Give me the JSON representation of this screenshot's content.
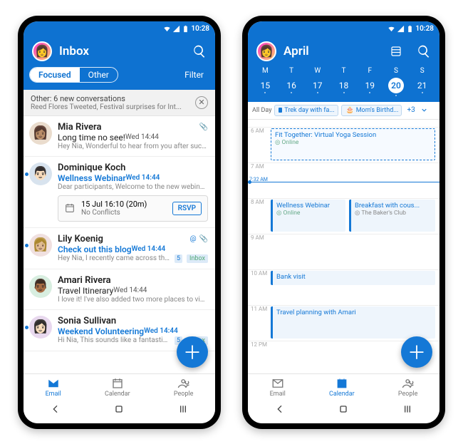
{
  "status": {
    "time": "10:28"
  },
  "inbox": {
    "title": "Inbox",
    "tabs": {
      "focused": "Focused",
      "other": "Other",
      "filter": "Filter"
    },
    "other_banner": {
      "title": "Other: 6 new conversations",
      "sub": "Reed Flores Tweeted, Festival surprises for Int..."
    },
    "meeting": {
      "time": "15 Jul 16:10 (20m)",
      "conflicts": "No Conflicts",
      "rsvp": "RSVP"
    },
    "messages": [
      {
        "sender": "Mia Rivera",
        "subject": "Long time no see!",
        "preview": "Hey Nia, Wonderful to hear from you after such...",
        "when": "Wed 14:44",
        "accent": false,
        "attach": true,
        "at": false,
        "unread": false,
        "count": null,
        "folder": null
      },
      {
        "sender": "Dominique Koch",
        "subject": "Wellness Webinar",
        "preview": "Dear participants, Welcome to the new webinar...",
        "when": "Wed 14:44",
        "accent": true,
        "attach": false,
        "at": false,
        "unread": true,
        "count": null,
        "folder": null
      },
      {
        "sender": "Lily Koenig",
        "subject": "Check out this blog",
        "preview": "Hey Nia, I recently came across this...",
        "when": "Wed 14:44",
        "accent": true,
        "attach": true,
        "at": true,
        "unread": true,
        "count": "5",
        "folder": "Inbox"
      },
      {
        "sender": "Amari Rivera",
        "subject": "Travel Itinerary",
        "preview": "I love it! I've also added two more places to vis...",
        "when": "Wed 14:44",
        "accent": false,
        "attach": false,
        "at": false,
        "unread": false,
        "count": null,
        "folder": null
      },
      {
        "sender": "Sonia Sullivan",
        "subject": "Weekend Volunteering",
        "preview": "Hi Nia, This sounds like a fantastic...",
        "when": "Wed 14:44",
        "accent": true,
        "attach": false,
        "at": false,
        "unread": true,
        "count": "5",
        "folder": "Inbox"
      }
    ]
  },
  "calendar": {
    "title": "April",
    "dow": [
      "M",
      "T",
      "W",
      "T",
      "F",
      "S",
      "S"
    ],
    "dates": [
      "15",
      "16",
      "17",
      "18",
      "19",
      "20",
      "21"
    ],
    "today_index": 5,
    "allday": {
      "label": "All Day",
      "chip1": "Trek day with fa...",
      "chip2": "Mom's Birthd...",
      "more": "+3"
    },
    "now_label": "7:32 AM",
    "events": {
      "yoga": {
        "title": "Fit Together: Virtual Yoga Session",
        "loc": "Online"
      },
      "webinar": {
        "title": "Wellness Webinar",
        "loc": "Online"
      },
      "breakfast": {
        "title": "Breakfast with cous...",
        "loc": "The Baker's Club"
      },
      "bank": {
        "title": "Bank visit"
      },
      "travel": {
        "title": "Travel planning with Amari"
      }
    },
    "hours": {
      "h6": "6 AM",
      "h7": "7 AM",
      "h8": "8 AM",
      "h9": "9 AM",
      "h10": "10 AM",
      "h11": "11 AM",
      "h12": "12 PM"
    }
  },
  "nav": {
    "email": "Email",
    "calendar": "Calendar",
    "people": "People"
  }
}
